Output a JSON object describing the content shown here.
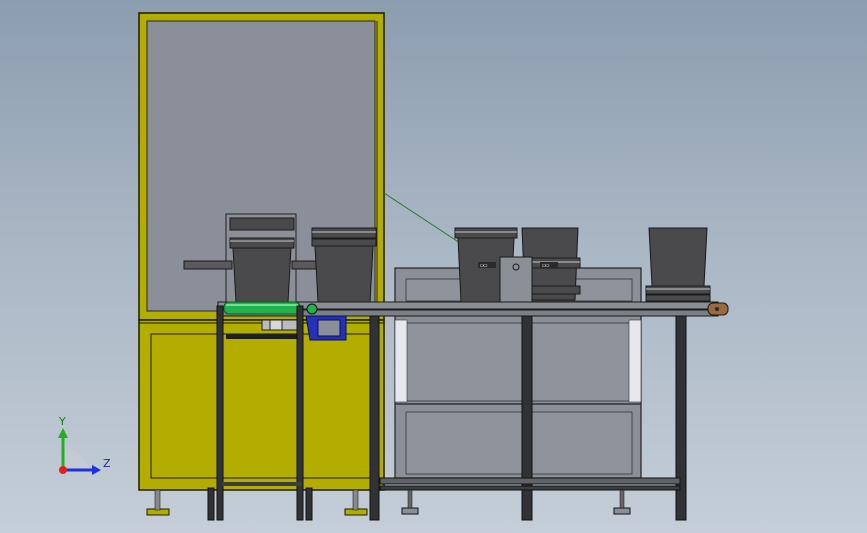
{
  "viewport": {
    "background_top": "#8c9db0",
    "background_bottom": "#c5ced8"
  },
  "colors": {
    "frame_yellow": "#b3ad00",
    "frame_yellow_light": "#c8c300",
    "glass_panel": "#8a8f9a",
    "bucket_dark": "#4a4a4d",
    "conveyor_gray": "#7f8489",
    "roller_green": "#22b14c",
    "motor_blue": "#2430b8",
    "axis_x": "#e02020",
    "axis_y": "#20b020",
    "axis_z": "#2030e0"
  },
  "triad": {
    "y_label": "Y",
    "z_label": "Z",
    "icon": "coordinate-triad-icon"
  },
  "bucket_tags": {
    "tag_1": "▭▭",
    "tag_2": "▭▭",
    "tag_3": "▭▭"
  }
}
